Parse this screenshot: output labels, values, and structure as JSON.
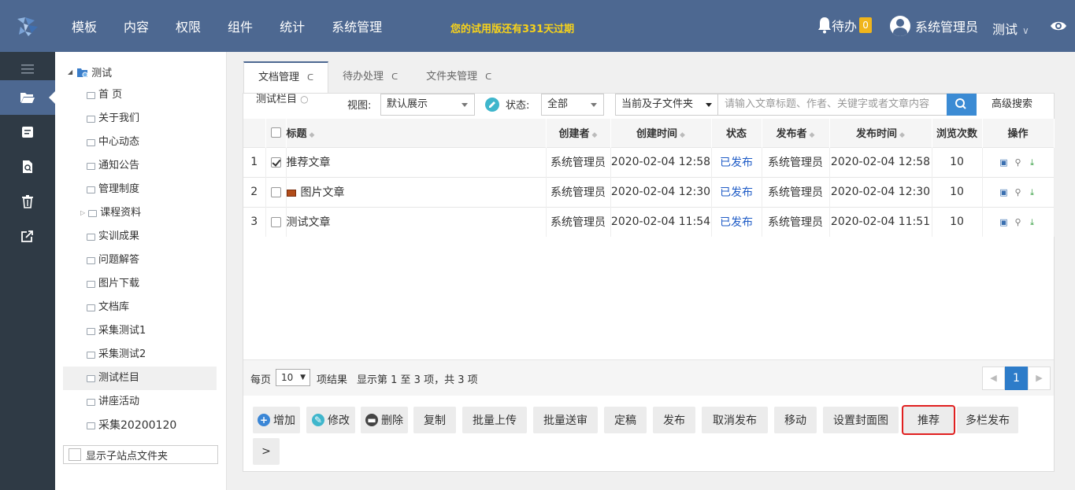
{
  "topbar": {
    "nav": [
      "模板",
      "内容",
      "权限",
      "组件",
      "统计",
      "系统管理"
    ],
    "trial_notice": "您的试用版还有331天过期",
    "todo_label": "待办",
    "todo_count": "0",
    "user_name": "系统管理员",
    "site_name": "测试",
    "site_chevron": "∨"
  },
  "iconbar": {
    "items": [
      "menu-icon",
      "folder-open-icon",
      "document-icon",
      "file-search-icon",
      "trash-icon",
      "export-icon"
    ]
  },
  "tree": {
    "root": "测试",
    "nodes": [
      "首 页",
      "关于我们",
      "中心动态",
      "通知公告",
      "管理制度",
      "课程资料",
      "实训成果",
      "问题解答",
      "图片下载",
      "文档库",
      "采集测试1",
      "采集测试2",
      "测试栏目",
      "讲座活动",
      "采集20200120"
    ],
    "show_subsite": "显示子站点文件夹"
  },
  "tabs": [
    {
      "label": "文档管理",
      "refresh": "ᑕ"
    },
    {
      "label": "待办处理",
      "refresh": "ᑕ"
    },
    {
      "label": "文件夹管理",
      "refresh": "ᑕ"
    }
  ],
  "filter": {
    "column_label": "测试栏目",
    "view_label": "视图:",
    "view_value": "默认展示",
    "status_label": "状态:",
    "status_value": "全部",
    "scope_value": "当前及子文件夹",
    "search_placeholder": "请输入文章标题、作者、关键字或者文章内容",
    "advanced_search": "高级搜索"
  },
  "table": {
    "headers": {
      "title": "标题",
      "creator": "创建者",
      "created": "创建时间",
      "status": "状态",
      "publisher": "发布者",
      "published": "发布时间",
      "views": "浏览次数",
      "ops": "操作"
    },
    "rows": [
      {
        "idx": "1",
        "title": "推荐文章",
        "creator": "系统管理员",
        "created": "2020-02-04 12:58",
        "status": "已发布",
        "publisher": "系统管理员",
        "published": "2020-02-04 12:58",
        "views": "10"
      },
      {
        "idx": "2",
        "title": "图片文章",
        "creator": "系统管理员",
        "created": "2020-02-04 12:30",
        "status": "已发布",
        "publisher": "系统管理员",
        "published": "2020-02-04 12:30",
        "views": "10"
      },
      {
        "idx": "3",
        "title": "测试文章",
        "creator": "系统管理员",
        "created": "2020-02-04 11:54",
        "status": "已发布",
        "publisher": "系统管理员",
        "published": "2020-02-04 11:51",
        "views": "10"
      }
    ]
  },
  "footer": {
    "per_page": "每页",
    "page_size": "10",
    "results_label": "项结果",
    "summary": "显示第 1 至 3 项，共 3 项",
    "current_page": "1"
  },
  "buttons": [
    "增加",
    "修改",
    "删除",
    "复制",
    "批量上传",
    "批量送审",
    "定稿",
    "发布",
    "取消发布",
    "移动",
    "设置封面图",
    "推荐",
    "多栏发布"
  ],
  "more": ">",
  "colors": {
    "topbar": "#4d6891",
    "sidebar": "#2f3a45",
    "link": "#1e5bc6",
    "highlight": "#e02020"
  }
}
